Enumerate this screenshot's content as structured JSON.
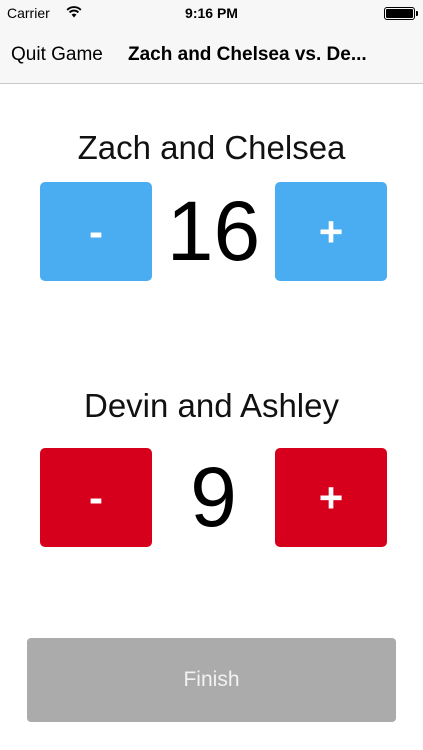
{
  "status_bar": {
    "carrier": "Carrier",
    "time": "9:16 PM",
    "wifi_icon": "wifi-icon",
    "battery_icon": "battery-icon"
  },
  "nav": {
    "back_label": "Quit Game",
    "title": "Zach and Chelsea vs. De..."
  },
  "teams": [
    {
      "name": "Zach and Chelsea",
      "score": "16",
      "minus_label": "-",
      "plus_label": "+",
      "color": "#4aacf1"
    },
    {
      "name": "Devin and Ashley",
      "score": "9",
      "minus_label": "-",
      "plus_label": "+",
      "color": "#d6001c"
    }
  ],
  "finish": {
    "label": "Finish",
    "color": "#ababab"
  }
}
